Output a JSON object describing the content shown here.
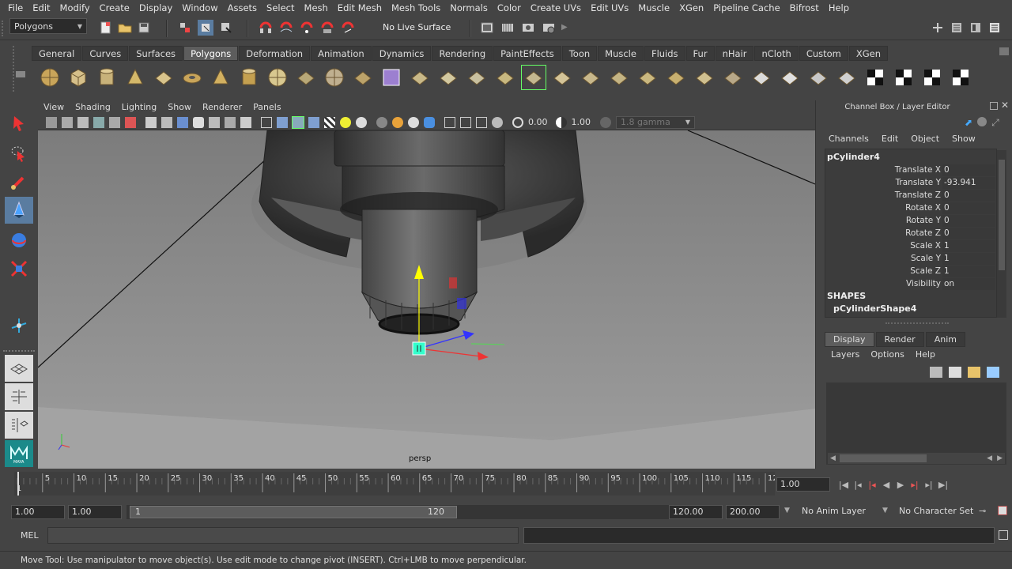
{
  "menu": [
    "File",
    "Edit",
    "Modify",
    "Create",
    "Display",
    "Window",
    "Assets",
    "Select",
    "Mesh",
    "Edit Mesh",
    "Mesh Tools",
    "Normals",
    "Color",
    "Create UVs",
    "Edit UVs",
    "Muscle",
    "XGen",
    "Pipeline Cache",
    "Bifrost",
    "Help"
  ],
  "status": {
    "mode_selector": "Polygons",
    "live_surface": "No Live Surface"
  },
  "shelf": {
    "tabs": [
      "General",
      "Curves",
      "Surfaces",
      "Polygons",
      "Deformation",
      "Animation",
      "Dynamics",
      "Rendering",
      "PaintEffects",
      "Toon",
      "Muscle",
      "Fluids",
      "Fur",
      "nHair",
      "nCloth",
      "Custom",
      "XGen"
    ],
    "active_tab": "Polygons",
    "icons": [
      "sphere-icon",
      "cube-icon",
      "cylinder-icon",
      "cone-icon",
      "plane-icon",
      "torus-icon",
      "pyramid-icon",
      "pipe-icon",
      "soccer-ball-icon",
      "separate-icon",
      "combine-icon",
      "smooth-icon",
      "bool-icon",
      "mirror-icon",
      "extrude-icon",
      "bridge-icon",
      "append-icon",
      "cut-faces-icon",
      "split-icon",
      "insert-edgeloop-icon",
      "offset-edgeloop-icon",
      "bevel-icon",
      "wedge-icon",
      "merge-icon",
      "poke-icon",
      "planar-map-icon",
      "cylindrical-map-icon",
      "spherical-map-icon",
      "automatic-map-icon",
      "uv-editor-icon",
      "checker-icon",
      "checker-icon-2",
      "checker-icon-3"
    ]
  },
  "viewport": {
    "menu": [
      "View",
      "Shading",
      "Lighting",
      "Show",
      "Renderer",
      "Panels"
    ],
    "exposure": "0.00",
    "gamma": "1.00",
    "color_space": "1.8 gamma",
    "camera_label": "persp"
  },
  "channel_box": {
    "title": "Channel Box / Layer Editor",
    "menu": [
      "Channels",
      "Edit",
      "Object",
      "Show"
    ],
    "object": "pCylinder4",
    "attributes": [
      {
        "label": "Translate X",
        "value": "0"
      },
      {
        "label": "Translate Y",
        "value": "-93.941"
      },
      {
        "label": "Translate Z",
        "value": "0"
      },
      {
        "label": "Rotate X",
        "value": "0"
      },
      {
        "label": "Rotate Y",
        "value": "0"
      },
      {
        "label": "Rotate Z",
        "value": "0"
      },
      {
        "label": "Scale X",
        "value": "1"
      },
      {
        "label": "Scale Y",
        "value": "1"
      },
      {
        "label": "Scale Z",
        "value": "1"
      },
      {
        "label": "Visibility",
        "value": "on"
      }
    ],
    "shapes_header": "SHAPES",
    "shape": "pCylinderShape4"
  },
  "layer_editor": {
    "tabs": [
      "Display",
      "Render",
      "Anim"
    ],
    "active_tab": "Display",
    "menu": [
      "Layers",
      "Options",
      "Help"
    ]
  },
  "timeline": {
    "ticks": [
      "5",
      "10",
      "15",
      "20",
      "25",
      "30",
      "35",
      "40",
      "45",
      "50",
      "55",
      "60",
      "65",
      "70",
      "75",
      "80",
      "85",
      "90",
      "95",
      "100",
      "105",
      "110",
      "115",
      "12"
    ],
    "start_marker": "1",
    "current_frame": "1.00"
  },
  "range": {
    "start": "1.00",
    "playback_start": "1.00",
    "slider_start": "1",
    "slider_end": "120",
    "playback_end": "120.00",
    "end": "200.00",
    "anim_layer": "No Anim Layer",
    "character_set": "No Character Set"
  },
  "command_line": {
    "label": "MEL"
  },
  "help_line": "Move Tool: Use manipulator to move object(s). Use edit mode to change pivot (INSERT).  Ctrl+LMB to move perpendicular."
}
